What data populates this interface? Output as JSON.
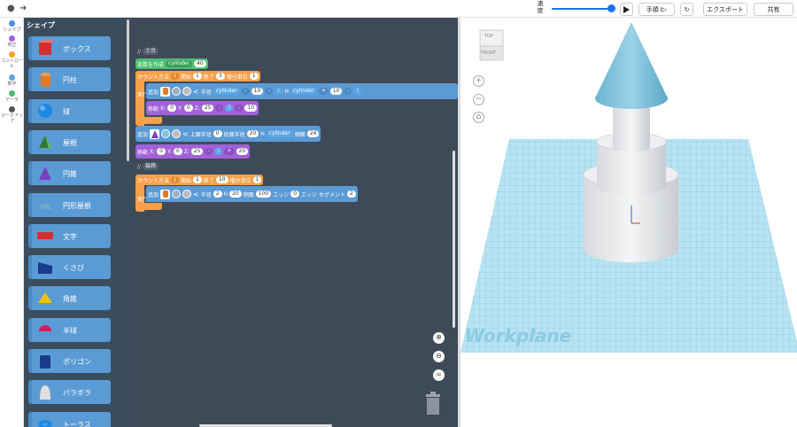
{
  "toolbar": {
    "speed_label": "速度",
    "step_label": "手順",
    "export_label": "エクスポート",
    "share_label": "共有",
    "accent": "#1a73e8"
  },
  "categories": [
    {
      "label": "シェイプ",
      "color": "#4a90e2"
    },
    {
      "label": "修正",
      "color": "#a162d8"
    },
    {
      "label": "コントロール",
      "color": "#f5a623"
    },
    {
      "label": "数学",
      "color": "#5aa6e6"
    },
    {
      "label": "データ",
      "color": "#4bbf73"
    },
    {
      "label": "マークアップ",
      "color": "#555555"
    }
  ],
  "flyout": {
    "title": "シェイプ",
    "items": [
      {
        "label": "ボックス",
        "icon": "box-icon"
      },
      {
        "label": "円柱",
        "icon": "cylinder-icon"
      },
      {
        "label": "球",
        "icon": "sphere-icon"
      },
      {
        "label": "屋根",
        "icon": "roof-icon"
      },
      {
        "label": "円錐",
        "icon": "cone-icon"
      },
      {
        "label": "円形屋根",
        "icon": "round-roof-icon"
      },
      {
        "label": "文字",
        "icon": "text-icon"
      },
      {
        "label": "くさび",
        "icon": "wedge-icon"
      },
      {
        "label": "角錐",
        "icon": "pyramid-icon"
      },
      {
        "label": "半球",
        "icon": "half-sphere-icon"
      },
      {
        "label": "ポリゴン",
        "icon": "polygon-icon"
      },
      {
        "label": "パラボラ",
        "icon": "paraboloid-icon"
      },
      {
        "label": "トーラス",
        "icon": "torus-icon"
      }
    ]
  },
  "code": {
    "comment1": "土台",
    "create_var": "変数を作成",
    "var_name": "cylinder",
    "var_value": "40",
    "loop1": {
      "label": "カウント方法",
      "var": "i",
      "start_label": "開始",
      "start": "1",
      "end_label": "終了",
      "end": "3",
      "step_label": "増分単位",
      "step": "1"
    },
    "do_label": "実行",
    "add_label": "追加",
    "radius_label": "半径",
    "minus": "-",
    "plus": "+",
    "ten": "10",
    "h_label": "H",
    "i_label": "i",
    "move_label": "移動",
    "x_label": "X:",
    "y_label": "Y:",
    "z_label": "Z:",
    "zero": "0",
    "z25": "25",
    "add2": {
      "top_radius_label": "上面半径",
      "top_radius": "0",
      "bottom_radius_label": "底面半径",
      "bottom_radius": "20",
      "sides_label": "側面",
      "sides": "24"
    },
    "move2_z": "25",
    "move2_plus": "20",
    "comment2": "装飾",
    "loop2": {
      "label": "カウント方法",
      "var": "j",
      "start_label": "開始",
      "start": "1",
      "end_label": "終了",
      "end": "10",
      "step_label": "増分単位",
      "step": "1"
    },
    "add3": {
      "radius_label": "半径",
      "radius": "2",
      "h_label": "H",
      "h": "20",
      "sides_label": "側面",
      "sides": "100",
      "edge_label": "エッジ",
      "edge": "0",
      "edge_seg_label": "エッジ セグメント",
      "edge_seg": "2"
    }
  },
  "viewport": {
    "cube_top": "TOP",
    "cube_front": "FRONT",
    "workplane_label": "Workplane",
    "grid_color": "#a8dcef",
    "shape_color": "#e8eaec",
    "cone_color": "#7ec3dd"
  }
}
